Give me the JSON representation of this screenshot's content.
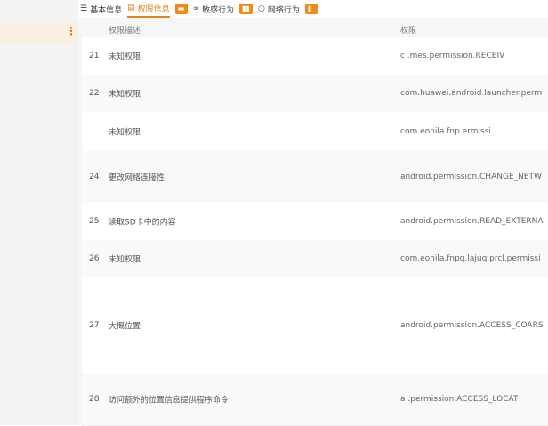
{
  "tabs": [
    {
      "label": "基本信息",
      "icon": "list-icon"
    },
    {
      "label": "权限信息",
      "icon": "doc-icon",
      "active": true
    },
    {
      "label": "敏感行为",
      "icon": "glasses-icon"
    },
    {
      "label": "网络行为",
      "icon": "search-icon"
    }
  ],
  "columns": {
    "desc": "权限描述",
    "perm": "权限"
  },
  "rows": [
    {
      "num": "21",
      "desc": "未知权限",
      "perm": "c                     .mes.permission.RECEIV"
    },
    {
      "num": "22",
      "desc": "未知权限",
      "perm": "com.huawei.android.launcher.perm"
    },
    {
      "num": "",
      "desc": "未知权限",
      "perm": "com.eonila.fnp                        ermissi"
    },
    {
      "num": "24",
      "desc": "更改网络连接性",
      "perm": "android.permission.CHANGE_NETW"
    },
    {
      "num": "25",
      "desc": "读取SD卡中的内容",
      "perm": "android.permission.READ_EXTERNA"
    },
    {
      "num": "26",
      "desc": "未知权限",
      "perm": "com.eonila.fnpq.lajuq.prcl.permissi"
    },
    {
      "num": "27",
      "desc": "大概位置",
      "perm": "android.permission.ACCESS_COARS"
    },
    {
      "num": "28",
      "desc": "访问额外的位置信息提供程序命令",
      "perm": "a                .permission.ACCESS_LOCAT"
    }
  ]
}
